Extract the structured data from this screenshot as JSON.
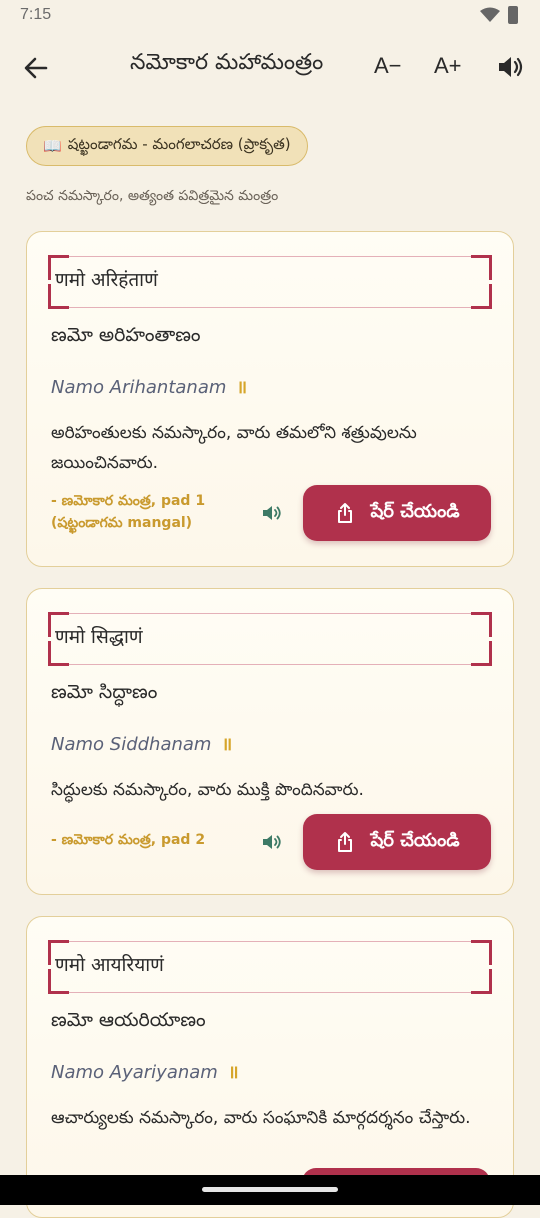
{
  "status": {
    "time": "7:15"
  },
  "appbar": {
    "title": "నమోకార మహామంత్రం",
    "font_minus": "A−",
    "font_plus": "A+"
  },
  "chip": {
    "icon": "📖",
    "label": "షట్ఖండాగమ - మంగలాచరణ (ప్రాకృత)"
  },
  "subtitle": "పంచ నమస్కారం, అత్యంత పవిత్రమైన మంత్రం",
  "cards": [
    {
      "devanagari": "णमो अरिहंताणं",
      "telugu": "ణమో అరిహంతాణం",
      "translit": "Namo Arihantanam",
      "pause": "॥",
      "meaning": "అరిహంతులకు నమస్కారం, వారు తమలోని శత్రువులను జయించినవారు.",
      "source": "- ణమోకార మంత్ర, pad 1 (షట్ఖండాగమ mangal)",
      "share": "షేర్ చేయండి"
    },
    {
      "devanagari": "णमो सिद्धाणं",
      "telugu": "ణమో సిద్ధాణం",
      "translit": "Namo Siddhanam",
      "pause": "॥",
      "meaning": "సిద్ధులకు నమస్కారం, వారు ముక్తి పొందినవారు.",
      "source": "- ణమోకార మంత్ర, pad 2",
      "share": "షేర్ చేయండి"
    },
    {
      "devanagari": "णमो आयरियाणं",
      "telugu": "ణమో ఆయరియాణం",
      "translit": "Namo Ayariyanam",
      "pause": "॥",
      "meaning": "ఆచార్యులకు నమస్కారం, వారు సంఘానికి మార్గదర్శనం చేస్తారు."
    }
  ],
  "colors": {
    "accent": "#b0314c",
    "gold": "#c99a2e",
    "background": "#f6f1e6"
  }
}
